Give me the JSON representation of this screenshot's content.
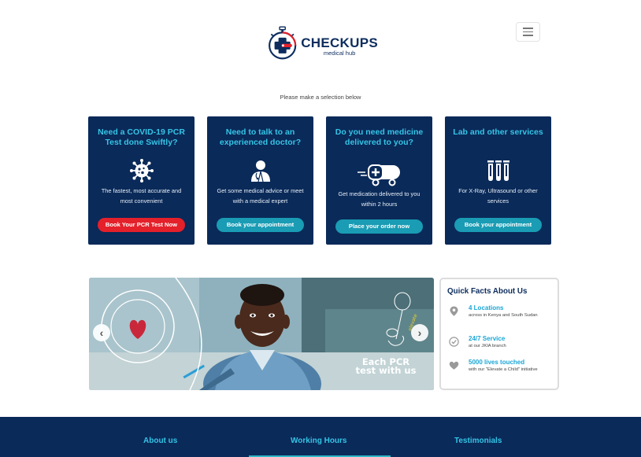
{
  "header": {
    "logo_name": "CHECKUPS",
    "logo_sub": "medical hub",
    "menu_icon": "hamburger-icon"
  },
  "prompt": "Please make a selection below",
  "cards": [
    {
      "title": "Need a COVID-19 PCR Test done Swiftly?",
      "icon": "virus-icon",
      "desc": "The fastest, most accurate and most convenient",
      "button": "Book Your PCR Test Now",
      "button_color": "#e4202a"
    },
    {
      "title": "Need to talk to an experienced doctor?",
      "icon": "doctor-icon",
      "desc": "Get some medical advice or meet with a medical expert",
      "button": "Book your appointment",
      "button_color": "#199cb4"
    },
    {
      "title": "Do you need medicine delivered to you?",
      "icon": "delivery-capsule-icon",
      "desc": "Get medication delivered to you within 2 hours",
      "button": "Place your order now",
      "button_color": "#199cb4"
    },
    {
      "title": "Lab and other services",
      "icon": "test-tubes-icon",
      "desc": "For X-Ray, Ultrasound or other services",
      "button": "Book your appointment",
      "button_color": "#199cb4"
    }
  ],
  "banner": {
    "caption_line1": "Each PCR",
    "caption_line2": "test with us",
    "stamp_text": "EVERY PCR TEST YOU TAKE HELPS US DONATE TO A SCHOOL",
    "prev_icon": "chevron-left-icon",
    "next_icon": "chevron-right-icon"
  },
  "facts": {
    "title": "Quick Facts About Us",
    "items": [
      {
        "head": "4 Locations",
        "sub": "across in Kenya and South Sudan",
        "icon": "location-pin-icon"
      },
      {
        "head": "24/7 Service",
        "sub": "at our JKIA branch",
        "icon": "check-circle-icon"
      },
      {
        "head": "5000 lives touched",
        "sub": "with our \"Elevate a Child\" initiative",
        "icon": "heart-icon"
      }
    ]
  },
  "footer": {
    "items": [
      "About us",
      "Working Hours",
      "Testimonials"
    ]
  },
  "colors": {
    "navy": "#0a2a59",
    "cyan": "#35c4e6",
    "red": "#e4202a",
    "teal": "#199cb4"
  }
}
